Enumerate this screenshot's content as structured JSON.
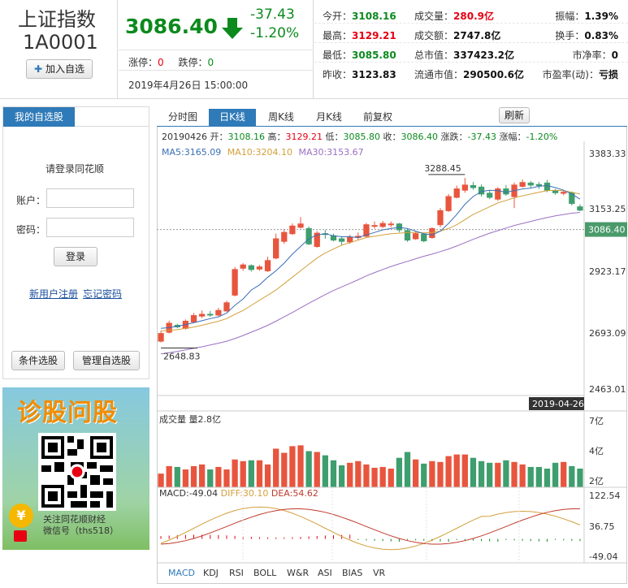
{
  "index": {
    "name": "上证指数",
    "code": "1A0001",
    "add_btn": "加入自选",
    "price": "3086.40",
    "change": "-37.43",
    "change_pct": "-1.20%",
    "limit_up_label": "涨停：",
    "limit_up": "0",
    "limit_down_label": "跌停：",
    "limit_down": "0",
    "datetime": "2019年4月26日 15:00:00"
  },
  "quote": {
    "col1": [
      {
        "label": "今开：",
        "value": "3108.16"
      },
      {
        "label": "最高：",
        "value": "3129.21"
      },
      {
        "label": "最低：",
        "value": "3085.80"
      },
      {
        "label": "昨收：",
        "value": "3123.83"
      }
    ],
    "col2": [
      {
        "label": "成交量：",
        "value": "280.9亿"
      },
      {
        "label": "成交额：",
        "value": "2747.8亿"
      },
      {
        "label": "总市值：",
        "value": "337423.2亿"
      },
      {
        "label": "流通市值：",
        "value": "290500.6亿"
      }
    ],
    "col3": [
      {
        "label": "振幅：",
        "value": "1.39%"
      },
      {
        "label": "换手：",
        "value": "0.83%"
      },
      {
        "label": "市净率：",
        "value": "0"
      },
      {
        "label": "市盈率(动)：",
        "value": "亏损"
      }
    ]
  },
  "sidebar": {
    "title": "我的自选股",
    "login_prompt": "请登录同花顺",
    "account_label": "账户：",
    "password_label": "密码：",
    "login_btn": "登录",
    "register_link": "新用户注册",
    "forgot_link": "忘记密码",
    "condition_btn": "条件选股",
    "manage_btn": "管理自选股"
  },
  "ad": {
    "headline": "诊股问股",
    "line1": "关注同花顺财经",
    "line2": "微信号（ths518）"
  },
  "tabs": [
    "分时图",
    "日K线",
    "周K线",
    "月K线",
    "前复权"
  ],
  "refresh": "刷新",
  "info_bar": {
    "date": "20190426",
    "open_label": "开：",
    "open": "3108.16",
    "high_label": "高：",
    "high": "3129.21",
    "low_label": "低：",
    "low": "3085.80",
    "close_label": "收：",
    "close": "3086.40",
    "chg_label": "涨跌：",
    "chg": "-37.43",
    "pct_label": "涨幅：",
    "pct": "-1.20%"
  },
  "ma": {
    "ma5_label": "MA5:",
    "ma5": "3165.09",
    "ma10_label": "MA10:",
    "ma10": "3204.10",
    "ma30_label": "MA30:",
    "ma30": "3153.67"
  },
  "volume_label": "成交量 量2.8亿",
  "macd": {
    "label": "MACD:",
    "macd": "-49.04",
    "diff_label": "DIFF:",
    "diff": "30.10",
    "dea_label": "DEA:",
    "dea": "54.62"
  },
  "indicators": [
    "MACD",
    "KDJ",
    "RSI",
    "BOLL",
    "W&R",
    "ASI",
    "BIAS",
    "VR"
  ],
  "colors": {
    "up": "#e8553e",
    "down": "#3f9e6e",
    "ma5": "#3a6fb5",
    "ma10": "#d4a03c",
    "ma30": "#9b6fc4",
    "accent": "#2f7ab8"
  },
  "chart_data": {
    "type": "candlestick",
    "price_axis": [
      "3383.33",
      "3153.25",
      "2923.17",
      "2693.09",
      "2463.01"
    ],
    "price_ylim": [
      2463.01,
      3383.33
    ],
    "max_label": "3288.45",
    "min_label": "2648.83",
    "last_label": "3086.40",
    "date_label": "2019-04-26",
    "candles": [
      [
        2650,
        2680,
        2690,
        2645
      ],
      [
        2685,
        2720,
        2730,
        2680
      ],
      [
        2712,
        2706,
        2718,
        2700
      ],
      [
        2700,
        2728,
        2735,
        2695
      ],
      [
        2725,
        2750,
        2760,
        2720
      ],
      [
        2748,
        2755,
        2770,
        2740
      ],
      [
        2755,
        2752,
        2768,
        2745
      ],
      [
        2752,
        2770,
        2780,
        2748
      ],
      [
        2768,
        2800,
        2808,
        2765
      ],
      [
        2830,
        2930,
        2940,
        2825
      ],
      [
        2935,
        2948,
        2955,
        2925
      ],
      [
        2945,
        2930,
        2950,
        2922
      ],
      [
        2932,
        2940,
        2948,
        2925
      ],
      [
        2925,
        2965,
        2980,
        2920
      ],
      [
        2975,
        3050,
        3070,
        2970
      ],
      [
        3040,
        3075,
        3088,
        3030
      ],
      [
        3070,
        3100,
        3110,
        3065
      ],
      [
        3095,
        3108,
        3135,
        3090
      ],
      [
        3090,
        3030,
        3098,
        3025
      ],
      [
        3020,
        3072,
        3080,
        3015
      ],
      [
        3070,
        3068,
        3085,
        3050
      ],
      [
        3062,
        3045,
        3070,
        3040
      ],
      [
        3050,
        3040,
        3060,
        3025
      ],
      [
        3038,
        3056,
        3066,
        3030
      ],
      [
        3055,
        3060,
        3075,
        3045
      ],
      [
        3060,
        3105,
        3112,
        3055
      ],
      [
        3100,
        3102,
        3118,
        3090
      ],
      [
        3098,
        3110,
        3120,
        3092
      ],
      [
        3105,
        3108,
        3118,
        3095
      ],
      [
        3108,
        3085,
        3112,
        3075
      ],
      [
        3082,
        3045,
        3090,
        3038
      ],
      [
        3050,
        3070,
        3078,
        3046
      ],
      [
        3068,
        3042,
        3072,
        3036
      ],
      [
        3055,
        3090,
        3095,
        3050
      ],
      [
        3105,
        3160,
        3170,
        3095
      ],
      [
        3160,
        3215,
        3225,
        3155
      ],
      [
        3212,
        3245,
        3258,
        3208
      ],
      [
        3240,
        3260,
        3288,
        3230
      ],
      [
        3258,
        3250,
        3272,
        3242
      ],
      [
        3252,
        3225,
        3262,
        3215
      ],
      [
        3228,
        3212,
        3240,
        3205
      ],
      [
        3205,
        3245,
        3252,
        3198
      ],
      [
        3245,
        3225,
        3260,
        3218
      ],
      [
        3215,
        3260,
        3270,
        3170
      ],
      [
        3255,
        3270,
        3282,
        3250
      ],
      [
        3268,
        3260,
        3276,
        3250
      ],
      [
        3262,
        3258,
        3272,
        3245
      ],
      [
        3268,
        3240,
        3280,
        3232
      ],
      [
        3238,
        3230,
        3245,
        3222
      ],
      [
        3228,
        3232,
        3240,
        3220
      ],
      [
        3230,
        3188,
        3235,
        3180
      ],
      [
        3175,
        3162,
        3185,
        3158
      ]
    ],
    "ma5": [
      2700,
      2703,
      2708,
      2715,
      2722,
      2730,
      2738,
      2745,
      2760,
      2790,
      2815,
      2850,
      2870,
      2900,
      2925,
      2955,
      2990,
      3020,
      3050,
      3065,
      3070,
      3062,
      3058,
      3058,
      3055,
      3065,
      3075,
      3085,
      3090,
      3095,
      3090,
      3080,
      3070,
      3065,
      3080,
      3110,
      3145,
      3185,
      3215,
      3235,
      3240,
      3238,
      3232,
      3238,
      3245,
      3248,
      3255,
      3258,
      3250,
      3240,
      3225,
      3205
    ],
    "ma10": [
      2690,
      2692,
      2695,
      2700,
      2705,
      2712,
      2720,
      2728,
      2738,
      2755,
      2770,
      2790,
      2810,
      2830,
      2850,
      2875,
      2900,
      2925,
      2950,
      2975,
      2995,
      3010,
      3025,
      3035,
      3045,
      3055,
      3060,
      3065,
      3070,
      3072,
      3075,
      3075,
      3073,
      3075,
      3080,
      3090,
      3105,
      3125,
      3145,
      3160,
      3175,
      3190,
      3200,
      3210,
      3218,
      3225,
      3232,
      3238,
      3240,
      3238,
      3232,
      3225
    ],
    "ma30": [
      2600,
      2605,
      2610,
      2616,
      2622,
      2628,
      2635,
      2642,
      2650,
      2660,
      2672,
      2685,
      2698,
      2712,
      2728,
      2745,
      2762,
      2780,
      2798,
      2815,
      2832,
      2848,
      2862,
      2876,
      2890,
      2905,
      2918,
      2930,
      2942,
      2952,
      2962,
      2972,
      2982,
      2990,
      3000,
      3010,
      3022,
      3035,
      3048,
      3060,
      3072,
      3082,
      3092,
      3102,
      3110,
      3118,
      3126,
      3133,
      3140,
      3145,
      3150,
      3153
    ],
    "volume_axis": [
      "7亿",
      "4亿",
      "2亿"
    ],
    "volumes": [
      1.5,
      2.4,
      2.3,
      2.0,
      2.4,
      2.6,
      2.0,
      2.3,
      2.0,
      3.2,
      3.0,
      3.1,
      3.1,
      2.6,
      4.5,
      4.0,
      4.8,
      4.9,
      4.2,
      4.1,
      3.7,
      3.1,
      2.5,
      2.8,
      3.0,
      2.6,
      2.2,
      2.3,
      2.1,
      3.4,
      4.1,
      3.2,
      2.7,
      3.0,
      2.9,
      3.6,
      3.8,
      3.8,
      3.4,
      3.0,
      2.8,
      2.8,
      3.1,
      2.9,
      2.6,
      2.3,
      2.3,
      2.1,
      2.8,
      2.9,
      2.4,
      2.1
    ],
    "macd_axis": [
      "122.54",
      "36.75",
      "-49.04"
    ],
    "macd_ylim": [
      -49.04,
      122.54
    ]
  }
}
